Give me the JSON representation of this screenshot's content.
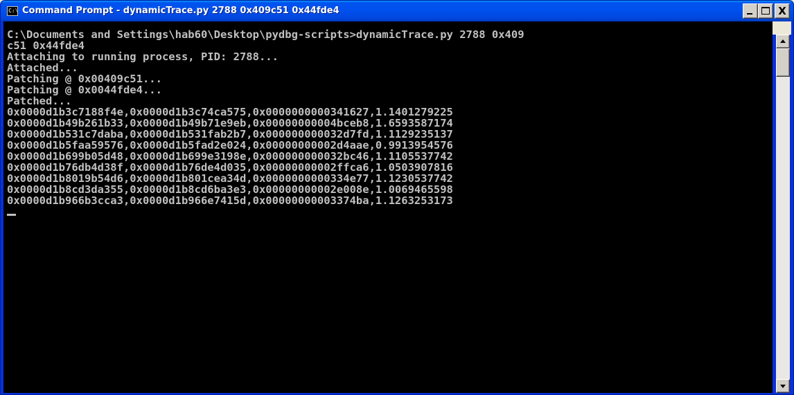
{
  "window": {
    "title": "Command Prompt - dynamicTrace.py 2788 0x409c51 0x44fde4",
    "icon_label": "C:\\"
  },
  "controls": {
    "close_label": "X"
  },
  "console": {
    "lines": [
      "C:\\Documents and Settings\\hab60\\Desktop\\pydbg-scripts>dynamicTrace.py 2788 0x409",
      "c51 0x44fde4",
      "Attaching to running process, PID: 2788...",
      "Attached...",
      "Patching @ 0x00409c51...",
      "Patching @ 0x0044fde4...",
      "Patched...",
      "0x0000d1b3c7188f4e,0x0000d1b3c74ca575,0x0000000000341627,1.1401279225",
      "0x0000d1b49b261b33,0x0000d1b49b71e9eb,0x00000000004bceb8,1.6593587174",
      "0x0000d1b531c7daba,0x0000d1b531fab2b7,0x000000000032d7fd,1.1129235137",
      "0x0000d1b5faa59576,0x0000d1b5fad2e024,0x00000000002d4aae,0.9913954576",
      "0x0000d1b699b05d48,0x0000d1b699e3198e,0x000000000032bc46,1.1105537742",
      "0x0000d1b76db4d38f,0x0000d1b76de4d035,0x00000000002ffca6,1.0503907816",
      "0x0000d1b8019b54d6,0x0000d1b801cea34d,0x0000000000334e77,1.1230537742",
      "0x0000d1b8cd3da355,0x0000d1b8cd6ba3e3,0x00000000002e008e,1.0069465598",
      "0x0000d1b966b3cca3,0x0000d1b966e7415d,0x00000000003374ba,1.1263253173"
    ]
  },
  "colors": {
    "console_bg": "#000000",
    "console_fg": "#c0c0c0",
    "titlebar_blue": "#0053ee"
  },
  "scrollbar": {
    "position_fraction": 0.0
  }
}
